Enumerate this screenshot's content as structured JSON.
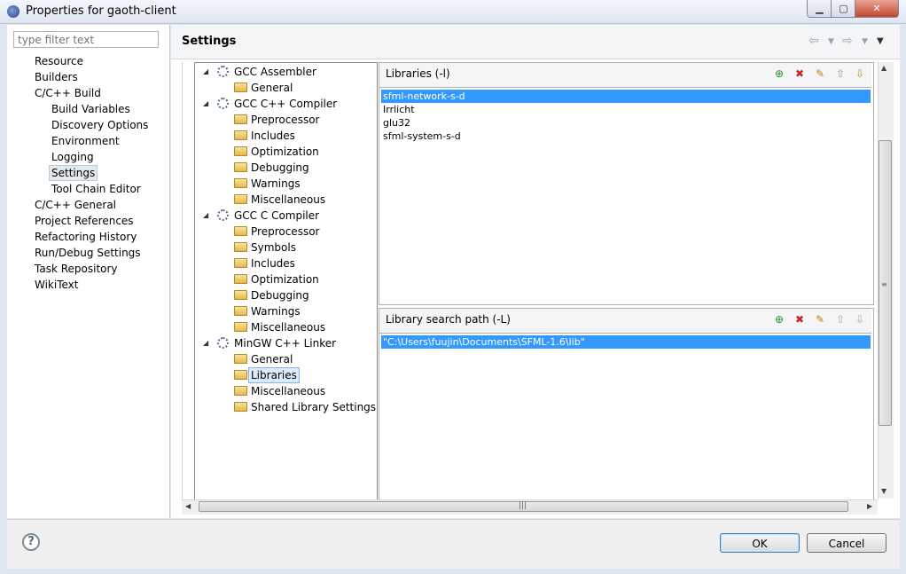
{
  "window": {
    "title": "Properties for gaoth-client"
  },
  "filter": {
    "placeholder": "type filter text"
  },
  "left_nav": [
    {
      "label": "Resource"
    },
    {
      "label": "Builders"
    },
    {
      "label": "C/C++ Build"
    },
    {
      "label": "Build Variables"
    },
    {
      "label": "Discovery Options"
    },
    {
      "label": "Environment"
    },
    {
      "label": "Logging"
    },
    {
      "label": "Settings",
      "selected": true
    },
    {
      "label": "Tool Chain Editor"
    },
    {
      "label": "C/C++ General"
    },
    {
      "label": "Project References"
    },
    {
      "label": "Refactoring History"
    },
    {
      "label": "Run/Debug Settings"
    },
    {
      "label": "Task Repository"
    },
    {
      "label": "WikiText"
    }
  ],
  "header": {
    "title": "Settings"
  },
  "tree": [
    {
      "label": "GCC Assembler",
      "type": "tool"
    },
    {
      "label": "General",
      "type": "option"
    },
    {
      "label": "GCC C++ Compiler",
      "type": "tool"
    },
    {
      "label": "Preprocessor",
      "type": "option"
    },
    {
      "label": "Includes",
      "type": "option"
    },
    {
      "label": "Optimization",
      "type": "option"
    },
    {
      "label": "Debugging",
      "type": "option"
    },
    {
      "label": "Warnings",
      "type": "option"
    },
    {
      "label": "Miscellaneous",
      "type": "option"
    },
    {
      "label": "GCC C Compiler",
      "type": "tool"
    },
    {
      "label": "Preprocessor",
      "type": "option"
    },
    {
      "label": "Symbols",
      "type": "option"
    },
    {
      "label": "Includes",
      "type": "option"
    },
    {
      "label": "Optimization",
      "type": "option"
    },
    {
      "label": "Debugging",
      "type": "option"
    },
    {
      "label": "Warnings",
      "type": "option"
    },
    {
      "label": "Miscellaneous",
      "type": "option"
    },
    {
      "label": "MinGW C++ Linker",
      "type": "tool"
    },
    {
      "label": "General",
      "type": "option"
    },
    {
      "label": "Libraries",
      "type": "option",
      "selected": true
    },
    {
      "label": "Miscellaneous",
      "type": "option"
    },
    {
      "label": "Shared Library Settings",
      "type": "option"
    }
  ],
  "libraries": {
    "title": "Libraries (-l)",
    "items": [
      "sfml-network-s-d",
      "Irrlicht",
      "glu32",
      "sfml-system-s-d"
    ]
  },
  "search_path": {
    "title": "Library search path (-L)",
    "items": [
      "\"C:\\Users\\fuujin\\Documents\\SFML-1.6\\lib\""
    ]
  },
  "buttons": {
    "ok": "OK",
    "cancel": "Cancel",
    "help": "?"
  },
  "colors": {
    "selection": "#3399ff",
    "tree_selection": "#dcebfc"
  },
  "icons": [
    "add-icon",
    "delete-icon",
    "edit-icon",
    "move-up-icon",
    "move-down-icon",
    "gear-icon",
    "folder-icon"
  ]
}
